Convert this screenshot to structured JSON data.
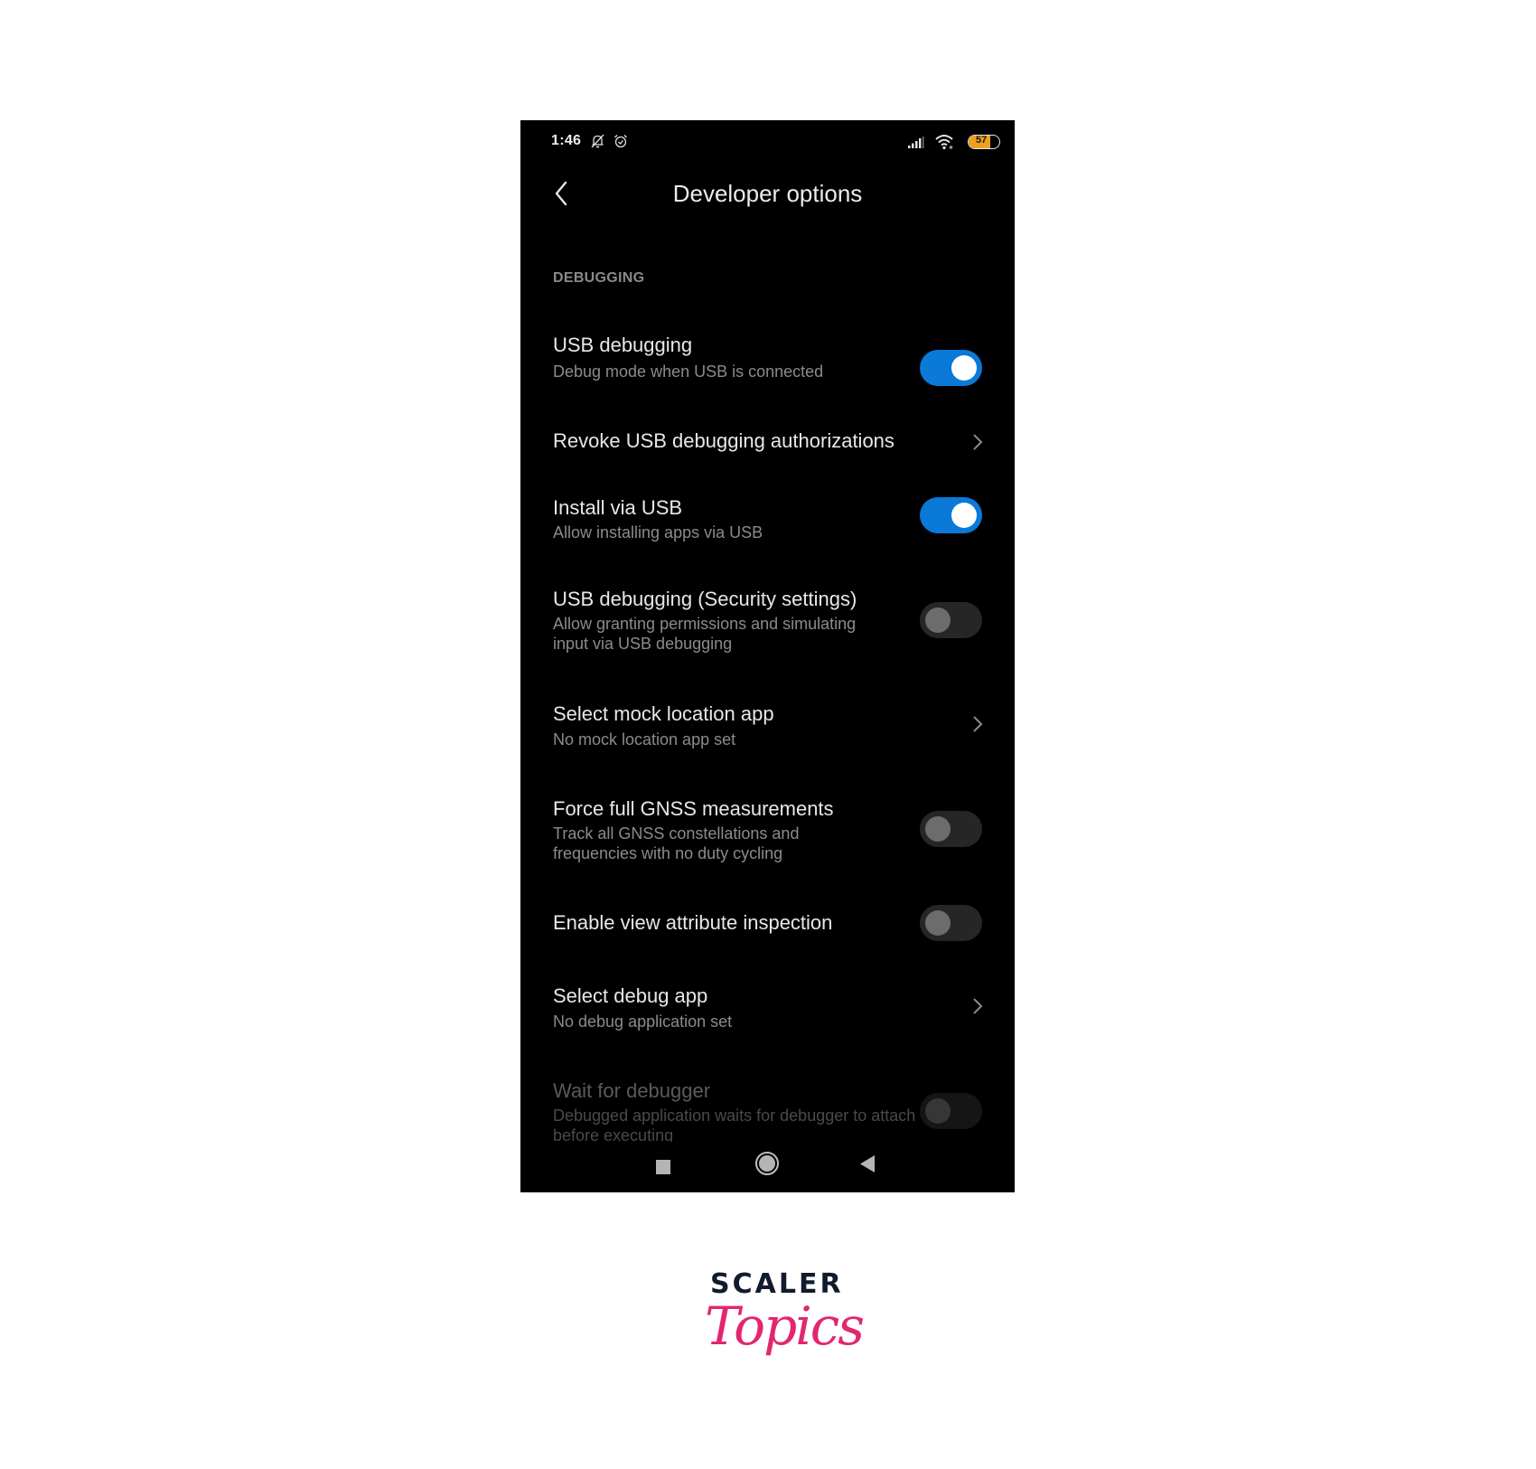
{
  "status_bar": {
    "time": "1:46",
    "left_icons": [
      "bell-off-icon",
      "alarm-icon"
    ],
    "right_icons": [
      "signal-icon",
      "wifi-icon",
      "battery-icon"
    ],
    "battery_level": "57",
    "battery_color": "#f0a020"
  },
  "header": {
    "title": "Developer options",
    "back_icon": "chevron-left-icon"
  },
  "section": {
    "label": "DEBUGGING"
  },
  "accent_color": "#0a79d8",
  "settings": [
    {
      "title": "USB debugging",
      "subtitle": "Debug mode when USB is connected",
      "control": "toggle",
      "on": true
    },
    {
      "title": "Revoke USB debugging authorizations",
      "subtitle": "",
      "control": "chevron"
    },
    {
      "title": "Install via USB",
      "subtitle": "Allow installing apps via USB",
      "control": "toggle",
      "on": true
    },
    {
      "title": "USB debugging (Security settings)",
      "subtitle": "Allow granting permissions and simulating input via USB debugging",
      "control": "toggle",
      "on": false
    },
    {
      "title": "Select mock location app",
      "subtitle": "No mock location app set",
      "control": "chevron"
    },
    {
      "title": "Force full GNSS measurements",
      "subtitle": "Track all GNSS constellations and frequencies with no duty cycling",
      "control": "toggle",
      "on": false
    },
    {
      "title": "Enable view attribute inspection",
      "subtitle": "",
      "control": "toggle",
      "on": false
    },
    {
      "title": "Select debug app",
      "subtitle": "No debug application set",
      "control": "chevron"
    },
    {
      "title": "Wait for debugger",
      "subtitle": "Debugged application waits for debugger to attach before executing",
      "control": "toggle",
      "on": false,
      "disabled": true
    }
  ],
  "nav_bar": {
    "buttons": [
      "recents-icon",
      "home-icon",
      "back-icon"
    ]
  },
  "logo": {
    "line1": "SCALER",
    "line2": "Topics"
  }
}
